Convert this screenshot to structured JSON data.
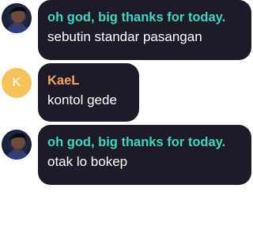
{
  "messages": [
    {
      "author": "oh god, big thanks for today.",
      "author_color": "#3fd7c2",
      "avatar_type": "photo",
      "text": "sebutin standar pasangan"
    },
    {
      "author": "KaeL",
      "author_color": "#f5a35b",
      "avatar_type": "letter",
      "avatar_letter": "K",
      "avatar_color": "#f6c35a",
      "text": "kontol gede"
    },
    {
      "author": "oh god, big thanks for today.",
      "author_color": "#3fd7c2",
      "avatar_type": "photo",
      "text": "otak lo bokep"
    }
  ],
  "colors": {
    "bubble_bg": "#1c1b27",
    "message_text": "#ffffff",
    "page_bg": "#ffffff"
  }
}
